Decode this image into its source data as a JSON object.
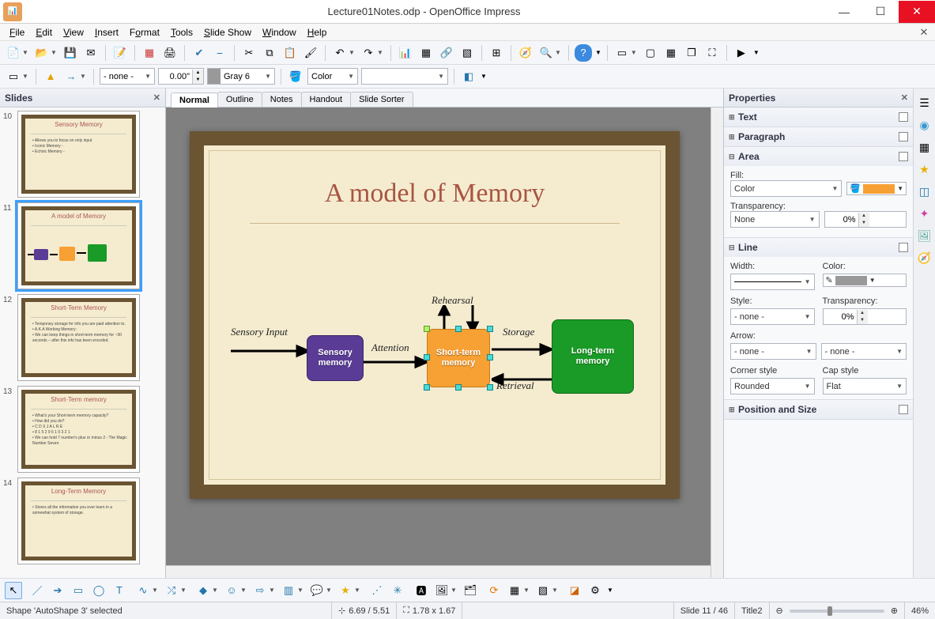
{
  "title": "Lecture01Notes.odp - OpenOffice Impress",
  "menu": [
    "File",
    "Edit",
    "View",
    "Insert",
    "Format",
    "Tools",
    "Slide Show",
    "Window",
    "Help"
  ],
  "fmt_toolbar": {
    "line_style": "- none -",
    "line_width": "0.00\"",
    "line_color_label": "Gray 6",
    "fill_type": "Color"
  },
  "slides_panel": {
    "title": "Slides"
  },
  "thumbs": [
    {
      "n": "10",
      "title": "Sensory Memory",
      "bullets": [
        "Allows you to focus on only input",
        "Iconic Memory -",
        "Echoic Memory -"
      ]
    },
    {
      "n": "11",
      "title": "A model of Memory",
      "diagram": true
    },
    {
      "n": "12",
      "title": "Short-Term Memory",
      "bullets": [
        "Temporary storage for info you are paid attention to.",
        "A.K.A Working Memory:",
        "We can keep things in short-term memory for ~30 seconds – after this info has been encoded."
      ]
    },
    {
      "n": "13",
      "title": "Short-Term memory",
      "bullets": [
        "What's your Short-term memory capacity?",
        "How did you do?",
        "  C D X J A L R E",
        "  8 1 5 2 9 6 1 0 3 2 1",
        "We can hold 7 number's plus or minus 2 - The Magic Number Seven"
      ]
    },
    {
      "n": "14",
      "title": "Long-Term Memory",
      "bullets": [
        "Stores all the information you ever learn in a somewhat system of storage."
      ]
    }
  ],
  "view_tabs": [
    "Normal",
    "Outline",
    "Notes",
    "Handout",
    "Slide Sorter"
  ],
  "slide": {
    "title": "A model of Memory",
    "labels": {
      "sensory_input": "Sensory Input",
      "attention": "Attention",
      "rehearsal": "Rehearsal",
      "storage": "Storage",
      "retrieval": "Retrieval"
    },
    "boxes": {
      "sensory": "Sensory memory",
      "short": "Short-term memory",
      "long": "Long-term memory"
    }
  },
  "props": {
    "title": "Properties",
    "sections": {
      "text": "Text",
      "paragraph": "Paragraph",
      "area": "Area",
      "line": "Line",
      "pos": "Position and Size"
    },
    "area": {
      "fill_label": "Fill:",
      "fill_type": "Color",
      "transparency_label": "Transparency:",
      "transparency_type": "None",
      "transparency_val": "0%"
    },
    "line": {
      "width_label": "Width:",
      "color_label": "Color:",
      "style_label": "Style:",
      "style_val": "- none -",
      "trans_label": "Transparency:",
      "trans_val": "0%",
      "arrow_label": "Arrow:",
      "arrow_start": "- none -",
      "arrow_end": "- none -",
      "corner_label": "Corner style",
      "corner_val": "Rounded",
      "cap_label": "Cap style",
      "cap_val": "Flat"
    }
  },
  "status": {
    "selection": "Shape 'AutoShape 3' selected",
    "pos": "6.69 / 5.51",
    "size": "1.78 x 1.67",
    "slide": "Slide 11 / 46",
    "template": "Title2",
    "zoom": "46%"
  }
}
